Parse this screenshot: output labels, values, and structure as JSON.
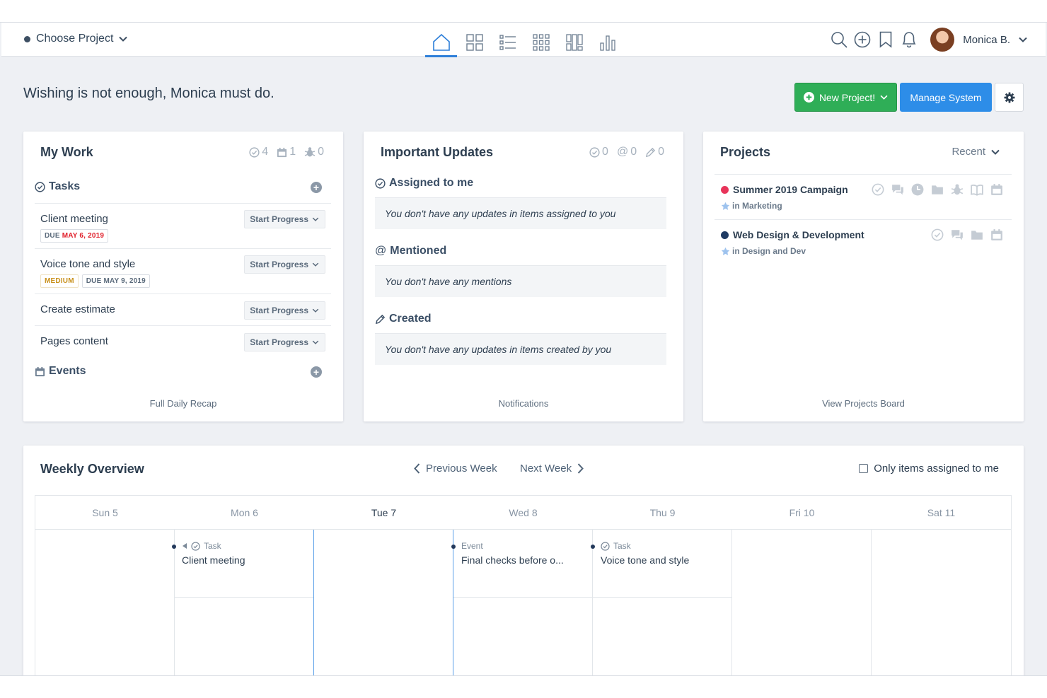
{
  "topbar": {
    "project_select": "Choose Project",
    "user_name": "Monica B."
  },
  "motto": "Wishing is not enough, Monica must do.",
  "actions": {
    "new_project": "New Project!",
    "manage_system": "Manage System"
  },
  "my_work": {
    "title": "My Work",
    "count_tasks": "4",
    "count_events": "1",
    "count_bugs": "0",
    "tasks_label": "Tasks",
    "events_label": "Events",
    "footer": "Full Daily Recap",
    "tasks": [
      {
        "name": "Client meeting",
        "status": "Start Progress",
        "due_prefix": "DUE",
        "due_date": "MAY 6, 2019"
      },
      {
        "name": "Voice tone and style",
        "status": "Start Progress",
        "priority": "MEDIUM",
        "due": "DUE MAY 9, 2019"
      },
      {
        "name": "Create estimate",
        "status": "Start Progress"
      },
      {
        "name": "Pages content",
        "status": "Start Progress"
      }
    ]
  },
  "updates": {
    "title": "Important Updates",
    "count_assigned": "0",
    "count_mentions": "0",
    "count_created": "0",
    "footer": "Notifications",
    "sections": [
      {
        "label": "Assigned to me",
        "empty": "You don't have any updates in items assigned to you"
      },
      {
        "label": "Mentioned",
        "empty": "You don't have any mentions"
      },
      {
        "label": "Created",
        "empty": "You don't have any updates in items created by you"
      }
    ]
  },
  "projects": {
    "title": "Projects",
    "filter": "Recent",
    "footer": "View Projects Board",
    "items": [
      {
        "name": "Summer 2019 Campaign",
        "group": "in Marketing",
        "color": "#e8345a"
      },
      {
        "name": "Web Design & Development",
        "group": "in Design and Dev",
        "color": "#1f3b63"
      }
    ]
  },
  "weekly": {
    "title": "Weekly Overview",
    "prev": "Previous Week",
    "next": "Next Week",
    "only_mine": "Only items assigned to me",
    "days": [
      "Sun 5",
      "Mon 6",
      "Tue 7",
      "Wed 8",
      "Thu 9",
      "Fri 10",
      "Sat 11"
    ],
    "events": [
      {
        "type": "Task",
        "title": "Client meeting"
      },
      {
        "type": "Event",
        "title": "Final checks before o..."
      },
      {
        "type": "Task",
        "title": "Voice tone and style"
      }
    ]
  },
  "colors": {
    "accent": "#2e7fd9",
    "success": "#2fae57",
    "primary": "#2d8de8"
  }
}
